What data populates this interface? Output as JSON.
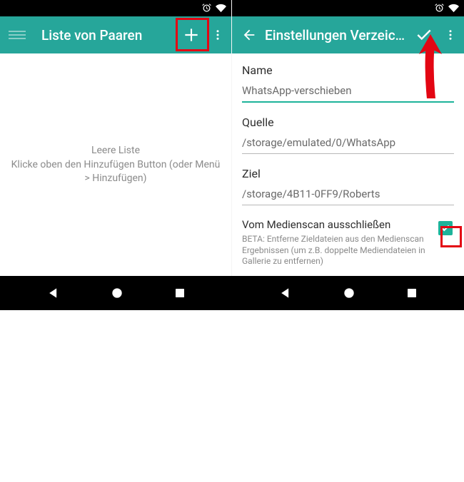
{
  "left": {
    "title": "Liste von Paaren",
    "empty_title": "Leere Liste",
    "empty_body": "Klicke oben den Hinzufügen Button (oder Menü > Hinzufügen)"
  },
  "right": {
    "title": "Einstellungen Verzeichni...",
    "field_name_label": "Name",
    "field_name_value": "WhatsApp-verschieben",
    "field_source_label": "Quelle",
    "field_source_value": "/storage/emulated/0/WhatsApp",
    "field_target_label": "Ziel",
    "field_target_value": "/storage/4B11-0FF9/Roberts",
    "exclude_title": "Vom Medienscan ausschließen",
    "exclude_desc": "BETA: Entferne Zieldateien aus den Medienscan Ergebnissen (um z.B. doppelte Mediendateien in Gallerie zu entfernen)",
    "exclude_checked": true
  },
  "colors": {
    "accent": "#26a69a",
    "underline": "#1db39a",
    "highlight": "#e30613"
  }
}
